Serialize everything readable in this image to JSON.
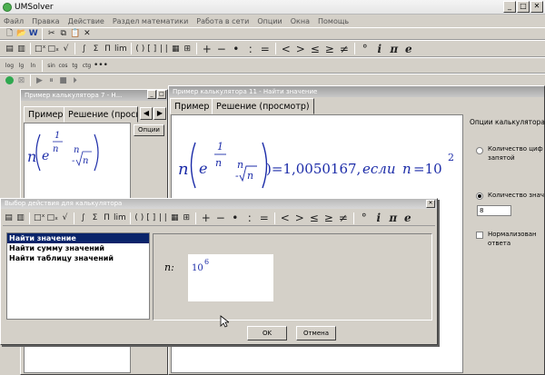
{
  "app": {
    "title": "UMSolver"
  },
  "menu": [
    "Файл",
    "Правка",
    "Действие",
    "Раздел математики",
    "Работа в сети",
    "Опции",
    "Окна",
    "Помощь"
  ],
  "toolbar_math": {
    "plus": "+",
    "minus": "−",
    "dot": "•",
    "colon": ":",
    "equals": "=",
    "lt": "<",
    "gt": ">",
    "le": "≤",
    "ge": "≥",
    "ne": "≠",
    "degree": "°",
    "i": "i",
    "pi": "π",
    "e": "e"
  },
  "toolbar_funcs": [
    "log",
    "lg",
    "ln",
    "sin",
    "cos",
    "tg",
    "ctg",
    "•••"
  ],
  "left_window": {
    "title": "Пример калькулятора 7 - Н...",
    "tabs": [
      "Пример",
      "Решение (просм"
    ],
    "options_button": "Опции",
    "formula": {
      "n": "n",
      "e": "e",
      "one": "1",
      "n1": "n",
      "n2": "n",
      "minus": "-",
      "n3": "n"
    }
  },
  "main_window": {
    "title": "Пример калькулятора 11 - Найти значение",
    "tabs": [
      "Пример",
      "Решение (просмотр)"
    ],
    "formula": {
      "n": "n",
      "e": "e",
      "one": "1",
      "n1": "n",
      "n2": "n",
      "minus": "-",
      "n3": "n",
      "result": ")=1,0050167,",
      "if_text": "если",
      "var": "n",
      "eq": "=10",
      "exp": "2"
    }
  },
  "options_panel": {
    "title": "Опции калькулятора",
    "option1": "Количество циф",
    "option1b": "запятой",
    "option2": "Количество знач",
    "value": "8",
    "option3": "Нормализован",
    "option3b": "ответа"
  },
  "dialog": {
    "title": "Выбор действия для калькулятора",
    "list": [
      "Найти значение",
      "Найти сумму значений",
      "Найти таблицу значений"
    ],
    "var_label": "n:",
    "input_base": "10",
    "input_exp": "6",
    "ok": "OK",
    "cancel": "Отмена"
  }
}
